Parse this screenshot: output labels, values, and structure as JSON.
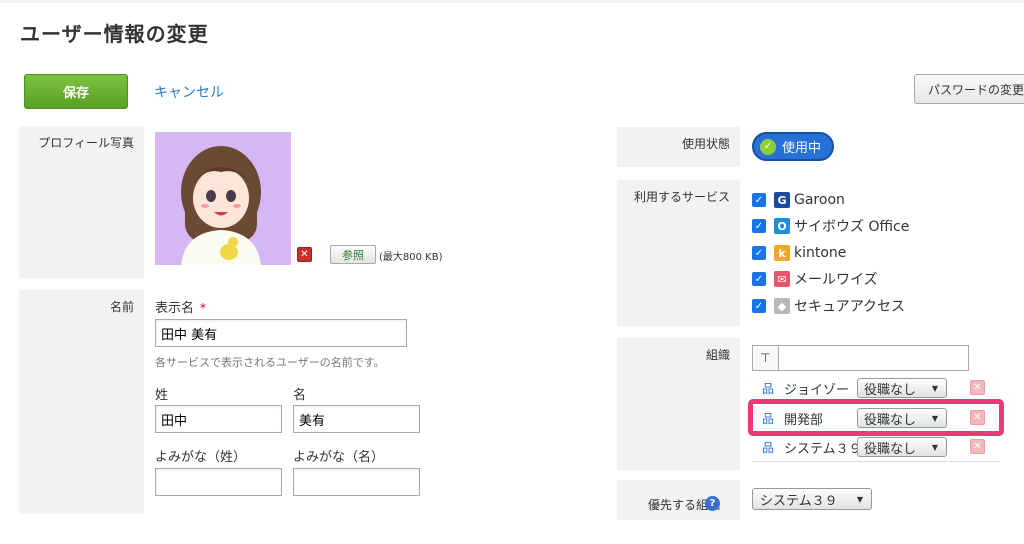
{
  "page": {
    "title": "ユーザー情報の変更"
  },
  "toolbar": {
    "save_label": "保存",
    "cancel_label": "キャンセル",
    "password_label": "パスワードの変更"
  },
  "profile_photo": {
    "label": "プロフィール写真",
    "browse_label": "参照",
    "max_size_note": "(最大800 KB)"
  },
  "name": {
    "label": "名前",
    "display_name_label": "表示名",
    "required_mark": "*",
    "display_name_value": "田中 美有",
    "hint": "各サービスで表示されるユーザーの名前です。",
    "last_name_label": "姓",
    "last_name_value": "田中",
    "first_name_label": "名",
    "first_name_value": "美有",
    "last_kana_label": "よみがな（姓）",
    "last_kana_value": "",
    "first_kana_label": "よみがな（名）",
    "first_kana_value": ""
  },
  "status": {
    "label": "使用状態",
    "value": "使用中"
  },
  "services": {
    "label": "利用するサービス",
    "items": [
      {
        "name": "Garoon",
        "checked": true,
        "icon": "garoon-icon",
        "color": "#1c4aa0",
        "glyph": "G"
      },
      {
        "name": "サイボウズ Office",
        "checked": true,
        "icon": "office-icon",
        "color": "#1d8fd8",
        "glyph": "O"
      },
      {
        "name": "kintone",
        "checked": true,
        "icon": "kintone-icon",
        "color": "#f5a623",
        "glyph": "k"
      },
      {
        "name": "メールワイズ",
        "checked": true,
        "icon": "mailwise-icon",
        "color": "#e9556a",
        "glyph": "✉"
      },
      {
        "name": "セキュアアクセス",
        "checked": true,
        "icon": "secure-access-icon",
        "color": "#b0b0b0",
        "glyph": "◆"
      }
    ]
  },
  "organization": {
    "label": "組織",
    "search_value": "",
    "rows": [
      {
        "name": "ジョイゾー",
        "role": "役職なし"
      },
      {
        "name": "開発部",
        "role": "役職なし"
      },
      {
        "name": "システム３９",
        "role": "役職なし"
      }
    ]
  },
  "priority_org": {
    "label": "優先する組織",
    "value": "システム３９"
  },
  "colors": {
    "accent": "#2670d6",
    "save": "#6bb12f",
    "highlight": "#ea3a72",
    "link": "#2a7bbf"
  }
}
